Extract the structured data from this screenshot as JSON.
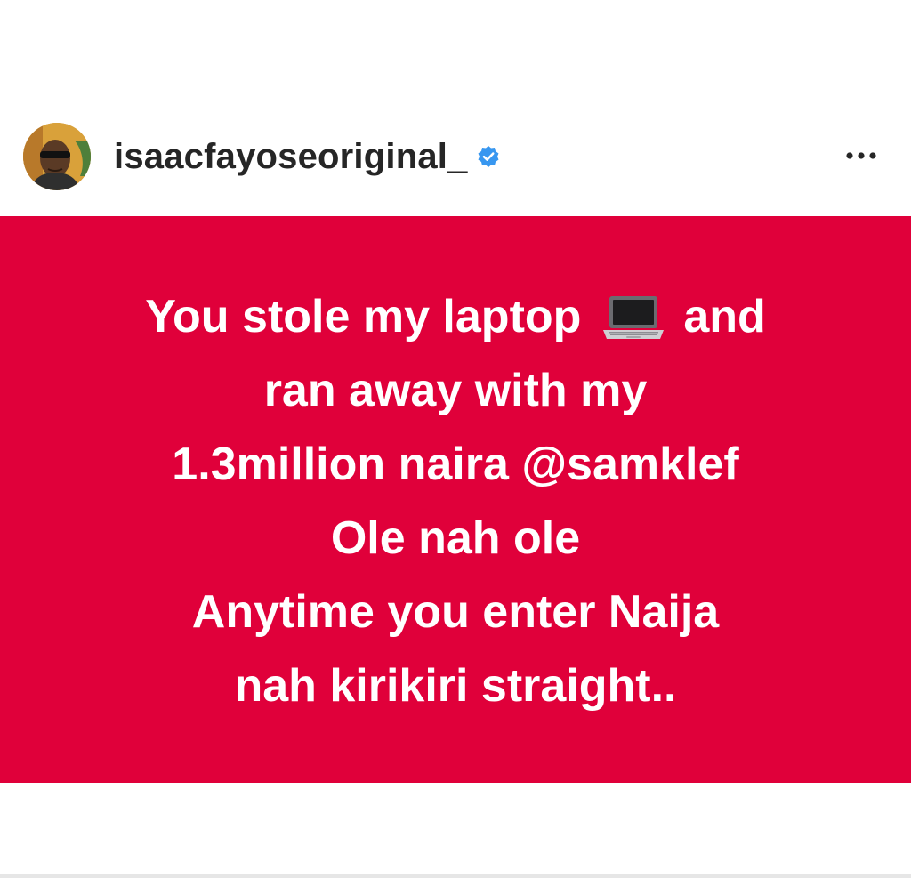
{
  "post_header": {
    "username": "isaacfayoseoriginal_",
    "verified_icon": "verified-badge-icon",
    "more_icon": "more-options-icon",
    "accent_color": "#3897f0"
  },
  "post": {
    "background_color": "#e0003a",
    "text_color": "#ffffff",
    "line1_before": "You stole my laptop",
    "line1_emoji": "laptop-emoji-icon",
    "line1_after": "and",
    "line2": "ran away with my",
    "line3": "1.3million naira @samklef",
    "line4": "Ole nah ole",
    "line5": "Anytime you enter Naija",
    "line6": "nah kirikiri straight.."
  }
}
